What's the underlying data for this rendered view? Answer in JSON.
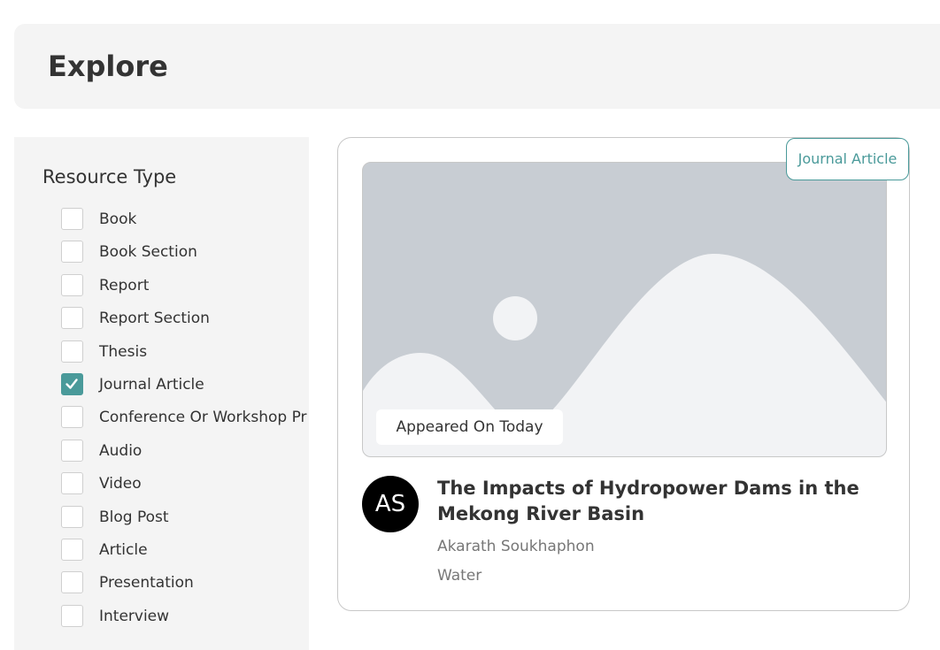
{
  "page": {
    "title": "Explore"
  },
  "filters": {
    "title": "Resource Type",
    "items": [
      {
        "label": "Book",
        "checked": false
      },
      {
        "label": "Book Section",
        "checked": false
      },
      {
        "label": "Report",
        "checked": false
      },
      {
        "label": "Report Section",
        "checked": false
      },
      {
        "label": "Thesis",
        "checked": false
      },
      {
        "label": "Journal Article",
        "checked": true
      },
      {
        "label": "Conference Or Workshop Pr",
        "checked": false
      },
      {
        "label": "Audio",
        "checked": false
      },
      {
        "label": "Video",
        "checked": false
      },
      {
        "label": "Blog Post",
        "checked": false
      },
      {
        "label": "Article",
        "checked": false
      },
      {
        "label": "Presentation",
        "checked": false
      },
      {
        "label": "Interview",
        "checked": false
      }
    ]
  },
  "card": {
    "type_badge": "Journal Article",
    "date_badge": "Appeared On Today",
    "thumbnail_icon": "image-placeholder-icon",
    "avatar_initials": "AS",
    "title": "The Impacts of Hydropower Dams in the Mekong River Basin",
    "author": "Akarath Soukhaphon",
    "subject": "Water"
  },
  "colors": {
    "accent": "#4a9a9a",
    "panel_bg": "#f4f4f4",
    "placeholder_bg": "#c8cdd3",
    "avatar_bg": "#000000"
  }
}
